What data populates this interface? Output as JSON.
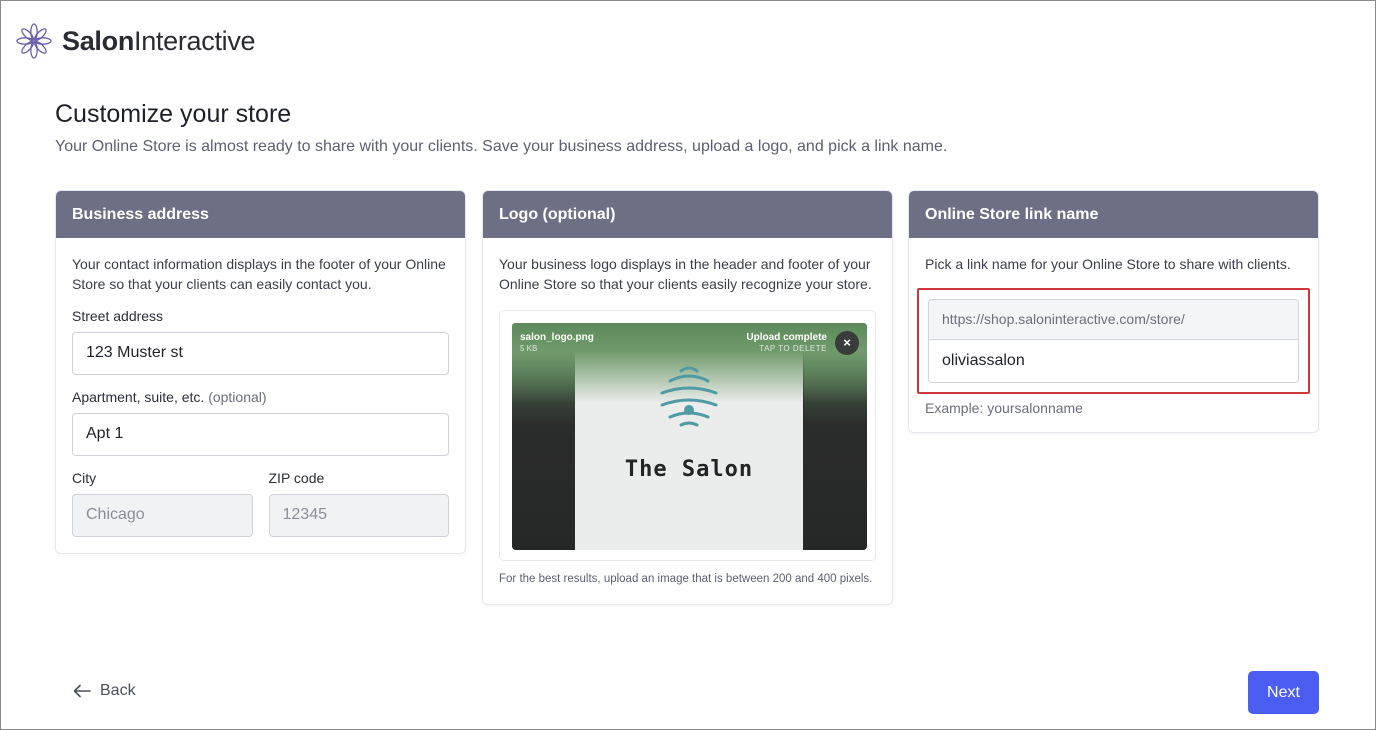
{
  "brand": {
    "name_bold": "Salon",
    "name_rest": "Interactive"
  },
  "page": {
    "title": "Customize your store",
    "subtitle": "Your Online Store is almost ready to share with your clients. Save your business address, upload a logo, and pick a link name."
  },
  "address_card": {
    "heading": "Business address",
    "description": "Your contact information displays in the footer of your Online Store so that your clients can easily contact you.",
    "street_label": "Street address",
    "street_value": "123 Muster st",
    "apt_label": "Apartment, suite, etc.",
    "apt_optional": "(optional)",
    "apt_value": "Apt 1",
    "city_label": "City",
    "city_value": "Chicago",
    "zip_label": "ZIP code",
    "zip_value": "12345"
  },
  "logo_card": {
    "heading": "Logo (optional)",
    "description": "Your business logo displays in the header and footer of your Online Store so that your clients easily recognize your store.",
    "file_name": "salon_logo.png",
    "file_size": "5 KB",
    "upload_status": "Upload complete",
    "upload_hint": "TAP TO DELETE",
    "delete_glyph": "×",
    "logo_text": "The Salon",
    "hint": "For the best results, upload an image that is between 200 and 400 pixels."
  },
  "link_card": {
    "heading": "Online Store link name",
    "description": "Pick a link name for your Online Store to share with clients.",
    "url_prefix": "https://shop.saloninteractive.com/store/",
    "link_value": "oliviassalon",
    "example": "Example: yoursalonname",
    "highlight_color": "#d0373a"
  },
  "footer": {
    "back_label": "Back",
    "next_label": "Next"
  },
  "colors": {
    "card_header": "#6d7085",
    "primary": "#4b5cf0",
    "logo_green": "#5d8a5c",
    "hive_teal": "#4f9aa3"
  },
  "icons": {
    "brand": "lotus-flower-icon",
    "back": "arrow-left-icon",
    "logo_mark": "beehive-icon",
    "delete": "close-icon"
  }
}
